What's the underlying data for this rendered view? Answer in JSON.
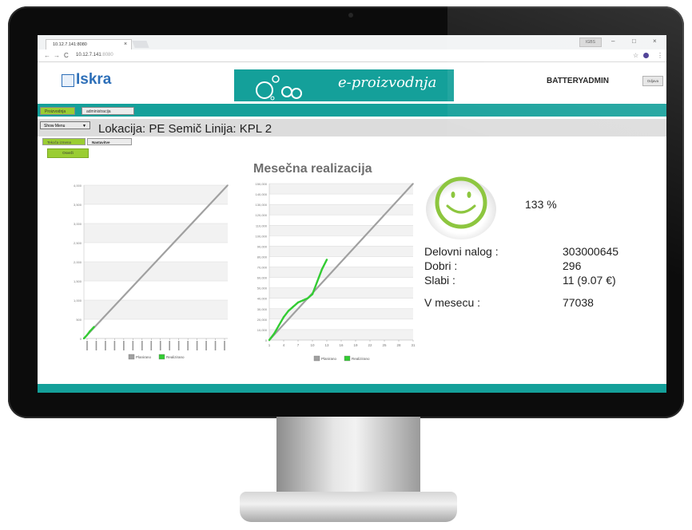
{
  "browser": {
    "tab_title": "10.12.7.141:8080",
    "tab_close": "×",
    "window_badge": "IGBS",
    "minimize": "–",
    "maximize": "□",
    "close": "×",
    "back": "←",
    "forward": "→",
    "reload": "C",
    "url_host": "10.12.7.141",
    "url_port": ":8080",
    "bookmark": "☆",
    "menu": "⋮"
  },
  "header": {
    "logo_text": "Iskra",
    "banner_title": "e-proizvodnja",
    "user": "BATTERYADMIN",
    "logout": "Odjava"
  },
  "nav": {
    "tabs": [
      "Proizvodnja",
      "administracija"
    ]
  },
  "toolbar": {
    "show_menu": "Show Menu",
    "caret": "▼",
    "location": "Lokacija: PE Semič Linija: KPL 2"
  },
  "subnav": {
    "tabs": [
      "Tekoča izmena",
      "Nastavitve"
    ],
    "button": "Osveži"
  },
  "chart_data": [
    {
      "type": "line",
      "title": "",
      "y_ticks": [
        "4,000",
        "3,500",
        "3,000",
        "2,500",
        "2,000",
        "1,500",
        "1,000",
        "500",
        "0"
      ],
      "ylim": [
        0,
        4000
      ],
      "grid": true,
      "legend": "bottom",
      "series": [
        {
          "name": "Planirano",
          "color": "#a0a0a0",
          "points": [
            [
              0,
              0
            ],
            [
              1,
              4000
            ]
          ]
        },
        {
          "name": "Realizirano",
          "color": "#33cc33",
          "points": [
            [
              0,
              0
            ],
            [
              0.02,
              80
            ],
            [
              0.04,
              180
            ],
            [
              0.06,
              260
            ],
            [
              0.07,
              300
            ]
          ]
        }
      ]
    },
    {
      "type": "line",
      "title": "Mesečna realizacija",
      "y_ticks": [
        "150,000",
        "140,000",
        "130,000",
        "120,000",
        "110,000",
        "100,000",
        "90,000",
        "80,000",
        "70,000",
        "60,000",
        "50,000",
        "40,000",
        "30,000",
        "20,000",
        "10,000",
        "0"
      ],
      "x_ticks": [
        "1",
        "4",
        "7",
        "10",
        "13",
        "16",
        "19",
        "22",
        "25",
        "28",
        "31"
      ],
      "xlim": [
        1,
        31
      ],
      "ylim": [
        0,
        150000
      ],
      "grid": true,
      "legend": "bottom",
      "series": [
        {
          "name": "Planirano",
          "color": "#a0a0a0",
          "points": [
            [
              1,
              0
            ],
            [
              31,
              150000
            ]
          ]
        },
        {
          "name": "Realizirano",
          "color": "#33cc33",
          "points": [
            [
              1,
              0
            ],
            [
              2,
              6000
            ],
            [
              3,
              14000
            ],
            [
              4,
              22000
            ],
            [
              5,
              28000
            ],
            [
              6,
              32000
            ],
            [
              7,
              36000
            ],
            [
              8,
              38000
            ],
            [
              9,
              40000
            ],
            [
              10,
              44000
            ],
            [
              11,
              56000
            ],
            [
              12,
              68000
            ],
            [
              13,
              77038
            ]
          ]
        }
      ]
    }
  ],
  "summary": {
    "percent": "133 %",
    "rows": [
      {
        "label": "Delovni nalog :",
        "value": "303000645"
      },
      {
        "label": "Dobri :",
        "value": "296"
      },
      {
        "label": "Slabi :",
        "value": "11 (9.07 €)"
      },
      {
        "label": "V mesecu :",
        "value": "77038"
      }
    ],
    "smiley_color": "#8dc63f"
  }
}
